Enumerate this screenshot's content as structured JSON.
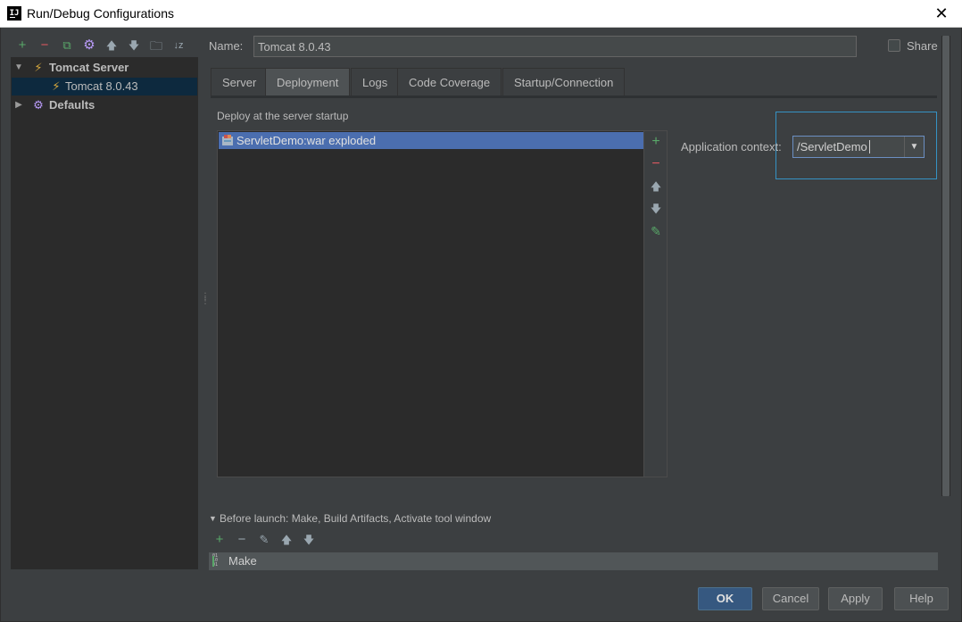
{
  "window": {
    "title": "Run/Debug Configurations",
    "logo_text": "IJ",
    "close": "✕"
  },
  "toolbar": {
    "add": "+",
    "remove": "−",
    "copy": "⧉",
    "settings": "⚙",
    "move_up": "🡅",
    "move_down": "🡇",
    "folder": "🗀",
    "sort": "↓z"
  },
  "tree": {
    "items": [
      {
        "label": "Tomcat Server",
        "expanded": true
      },
      {
        "label": "Tomcat 8.0.43",
        "selected": true
      },
      {
        "label": "Defaults",
        "expanded": false
      }
    ]
  },
  "name_row": {
    "label": "Name:",
    "value": "Tomcat 8.0.43",
    "share_label": "Share",
    "share_checked": false
  },
  "tabs": [
    {
      "label": "Server",
      "active": false
    },
    {
      "label": "Deployment",
      "active": true
    },
    {
      "label": "Logs",
      "active": false
    },
    {
      "label": "Code Coverage",
      "active": false
    },
    {
      "label": "Startup/Connection",
      "active": false
    }
  ],
  "deployment": {
    "caption": "Deploy at the server startup",
    "artifacts": [
      "ServletDemo:war exploded"
    ],
    "list_buttons": {
      "add": "+",
      "remove": "−",
      "up": "🡅",
      "down": "🡇",
      "edit": "✎"
    },
    "app_context_label": "Application context:",
    "app_context_value": "/ServletDemo",
    "dropdown_arrow": "▼"
  },
  "before_launch": {
    "expand_arrow": "▼",
    "title": "Before launch: Make, Build Artifacts, Activate tool window",
    "buttons": {
      "add": "+",
      "remove": "−",
      "edit": "✎",
      "up": "🡅",
      "down": "🡇"
    },
    "items": [
      {
        "label": "Make",
        "icon_text": "01 10 01"
      }
    ]
  },
  "buttons": {
    "ok": "OK",
    "cancel": "Cancel",
    "apply": "Apply",
    "help": "Help"
  },
  "colors": {
    "accent": "#4b6eaf",
    "focus": "#3592c4",
    "add_green": "#59a869",
    "remove_red": "#db5860",
    "gear_purple": "#b99bf8"
  }
}
